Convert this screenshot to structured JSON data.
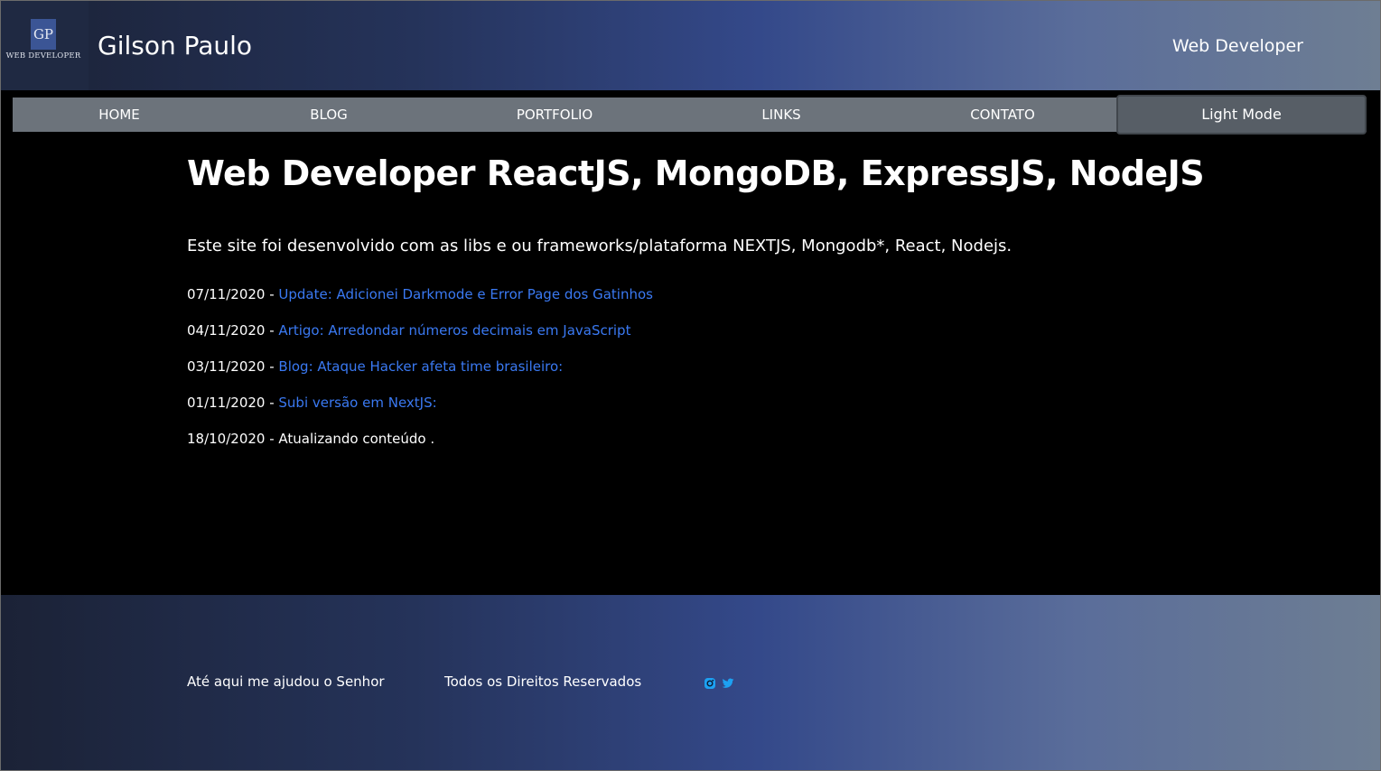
{
  "header": {
    "logo_initials": "GP",
    "logo_subtitle": "WEB DEVELOPER",
    "site_name": "Gilson Paulo",
    "role": "Web Developer"
  },
  "nav": {
    "items": [
      "HOME",
      "BLOG",
      "PORTFOLIO",
      "LINKS",
      "CONTATO"
    ],
    "mode_toggle": "Light Mode"
  },
  "main": {
    "title": "Web Developer ReactJS, MongoDB, ExpressJS, NodeJS",
    "intro": "Este site foi desenvolvido com as libs e ou frameworks/plataforma NEXTJS, Mongodb*, React, Nodejs.",
    "updates": [
      {
        "date": "07/11/2020 - ",
        "text": "Update: Adicionei Darkmode e Error Page dos Gatinhos",
        "link": true
      },
      {
        "date": "04/11/2020 - ",
        "text": "Artigo: Arredondar números decimais em JavaScript",
        "link": true
      },
      {
        "date": "03/11/2020 - ",
        "text": "Blog: Ataque Hacker afeta time brasileiro:",
        "link": true
      },
      {
        "date": "01/11/2020 - ",
        "text": "Subi versão em NextJS:",
        "link": true
      },
      {
        "date": "18/10/2020 - ",
        "text": "Atualizando conteúdo .",
        "link": false
      }
    ]
  },
  "footer": {
    "motto": "Até aqui me ajudou o Senhor",
    "rights": "Todos os Direitos Reservados",
    "social_icons": [
      "instagram-icon",
      "twitter-icon"
    ]
  },
  "colors": {
    "link": "#3a79f2",
    "nav_bg": "#6c737b",
    "mode_bg": "#575e66"
  }
}
